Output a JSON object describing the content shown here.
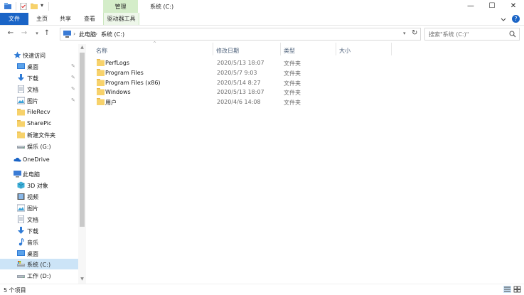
{
  "window": {
    "title": "系统 (C:)",
    "manage_tab": "管理",
    "minimize": "—",
    "maximize": "☐",
    "close": "✕"
  },
  "ribbon": {
    "file": "文件",
    "home": "主页",
    "share": "共享",
    "view": "查看",
    "drive_tools": "驱动器工具",
    "help": "?"
  },
  "address": {
    "root": "此电脑",
    "current": "系统 (C:)",
    "separator": "›",
    "search_placeholder": "搜索\"系统 (C:)\""
  },
  "nav": {
    "quick_access": "快速访问",
    "items_quick": [
      {
        "label": "桌面",
        "icon": "desktop-icon",
        "pinned": true
      },
      {
        "label": "下载",
        "icon": "download-icon",
        "pinned": true
      },
      {
        "label": "文档",
        "icon": "document-icon",
        "pinned": true
      },
      {
        "label": "图片",
        "icon": "pictures-icon",
        "pinned": true
      },
      {
        "label": "FileRecv",
        "icon": "folder-icon",
        "pinned": false
      },
      {
        "label": "SharePic",
        "icon": "folder-icon",
        "pinned": false
      },
      {
        "label": "新建文件夹",
        "icon": "folder-icon",
        "pinned": false
      },
      {
        "label": "娱乐 (G:)",
        "icon": "drive-icon",
        "pinned": false
      }
    ],
    "onedrive": "OneDrive",
    "this_pc": "此电脑",
    "items_pc": [
      {
        "label": "3D 对象",
        "icon": "3d-objects-icon"
      },
      {
        "label": "视频",
        "icon": "video-icon"
      },
      {
        "label": "图片",
        "icon": "pictures-icon"
      },
      {
        "label": "文档",
        "icon": "document-icon"
      },
      {
        "label": "下载",
        "icon": "download-icon"
      },
      {
        "label": "音乐",
        "icon": "music-icon"
      },
      {
        "label": "桌面",
        "icon": "desktop-icon"
      },
      {
        "label": "系统 (C:)",
        "icon": "system-drive-icon",
        "selected": true
      },
      {
        "label": "工作 (D:)",
        "icon": "drive-icon"
      }
    ],
    "pin_glyph": "📌"
  },
  "columns": {
    "name": "名称",
    "date": "修改日期",
    "type": "类型",
    "size": "大小"
  },
  "files": [
    {
      "name": "PerfLogs",
      "date": "2020/5/13 18:07",
      "type": "文件夹"
    },
    {
      "name": "Program Files",
      "date": "2020/5/7 9:03",
      "type": "文件夹"
    },
    {
      "name": "Program Files (x86)",
      "date": "2020/5/14 8:27",
      "type": "文件夹"
    },
    {
      "name": "Windows",
      "date": "2020/5/13 18:07",
      "type": "文件夹"
    },
    {
      "name": "用户",
      "date": "2020/4/6 14:08",
      "type": "文件夹"
    }
  ],
  "status": {
    "item_count": "5 个项目"
  },
  "colors": {
    "accent": "#1a64c6",
    "manage_tab": "#d4edc9",
    "selection": "#cce4f7",
    "folder": "#f7d26b"
  }
}
